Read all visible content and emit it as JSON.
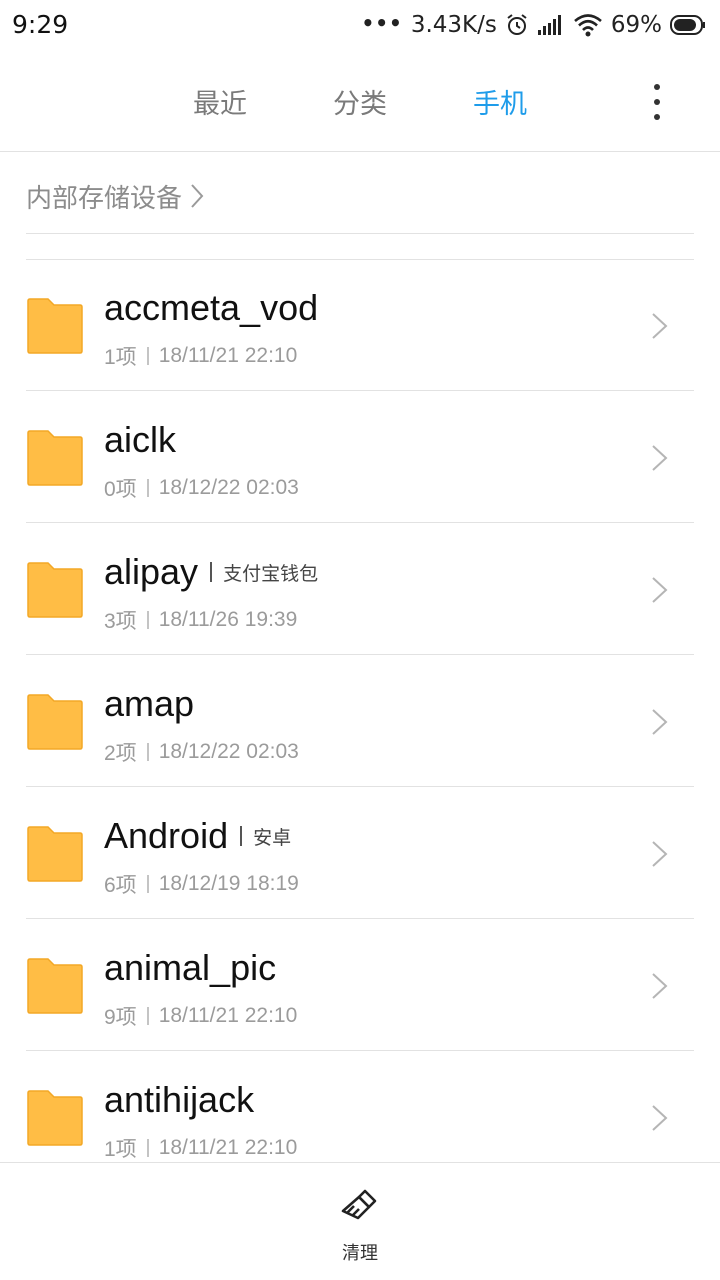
{
  "status_bar": {
    "time": "9:29",
    "dots": "•••",
    "net_speed": "3.43K/s",
    "battery": "69%",
    "icons": [
      "alarm-icon",
      "signal-icon",
      "wifi-icon",
      "battery-icon"
    ]
  },
  "tabs": [
    {
      "label": "最近",
      "active": false
    },
    {
      "label": "分类",
      "active": false
    },
    {
      "label": "手机",
      "active": true
    }
  ],
  "colors": {
    "accent": "#1e9cea",
    "folder": "#ffbd45",
    "folder_tab": "#f8ab25"
  },
  "breadcrumb": {
    "label": "内部存储设备"
  },
  "folders": [
    {
      "name": "accmeta_vod",
      "alias": "",
      "count": "1项",
      "date": "18/11/21 22:10"
    },
    {
      "name": "aiclk",
      "alias": "",
      "count": "0项",
      "date": "18/12/22 02:03"
    },
    {
      "name": "alipay",
      "alias": "支付宝钱包",
      "count": "3项",
      "date": "18/11/26 19:39"
    },
    {
      "name": "amap",
      "alias": "",
      "count": "2项",
      "date": "18/12/22 02:03"
    },
    {
      "name": "Android",
      "alias": "安卓",
      "count": "6项",
      "date": "18/12/19 18:19"
    },
    {
      "name": "animal_pic",
      "alias": "",
      "count": "9项",
      "date": "18/11/21 22:10"
    },
    {
      "name": "antihijack",
      "alias": "",
      "count": "1项",
      "date": "18/11/21 22:10"
    }
  ],
  "bottom_bar": {
    "clean_label": "清理"
  }
}
